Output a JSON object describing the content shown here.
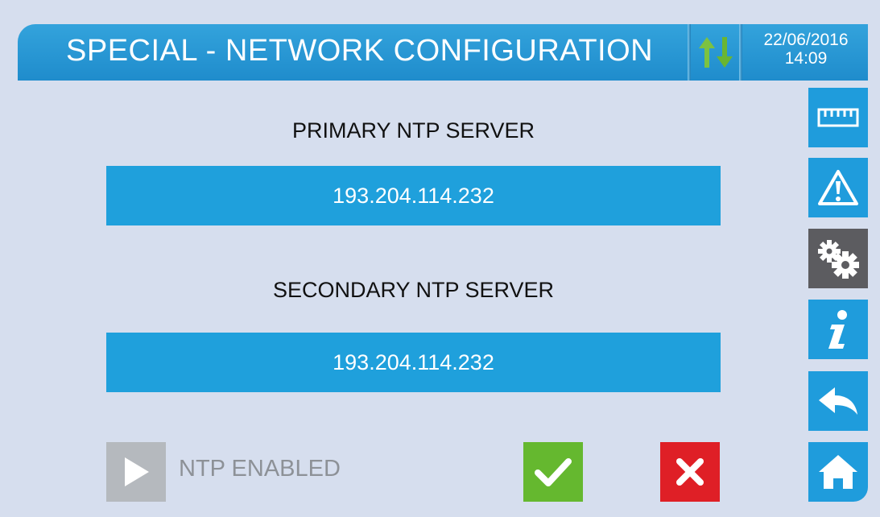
{
  "header": {
    "title": "SPECIAL - NETWORK CONFIGURATION",
    "date": "22/06/2016",
    "time": "14:09",
    "connection_icon": "up-down-arrows-icon"
  },
  "primary": {
    "label": "PRIMARY NTP SERVER",
    "value": "193.204.114.232"
  },
  "secondary": {
    "label": "SECONDARY NTP SERVER",
    "value": "193.204.114.232"
  },
  "ntp": {
    "label": "NTP ENABLED",
    "icon": "play-icon"
  },
  "actions": {
    "confirm_icon": "checkmark-icon",
    "cancel_icon": "close-icon"
  },
  "sidebar": {
    "items": [
      {
        "name": "measurements",
        "icon": "ruler-icon"
      },
      {
        "name": "alarms",
        "icon": "warning-icon"
      },
      {
        "name": "settings",
        "icon": "gears-icon",
        "active": true
      },
      {
        "name": "info",
        "icon": "info-icon"
      },
      {
        "name": "back",
        "icon": "back-arrow-icon"
      },
      {
        "name": "home",
        "icon": "home-icon"
      }
    ]
  },
  "colors": {
    "background": "#d6deee",
    "header": "#2797d4",
    "field": "#1fa0dc",
    "sidebar_button": "#1f9cdc",
    "sidebar_active": "#5c5c60",
    "confirm": "#65b82f",
    "cancel": "#df1f26",
    "toggle_off": "#b5b9be",
    "arrow_up": "#7cc242",
    "arrow_down": "#6ab532"
  }
}
